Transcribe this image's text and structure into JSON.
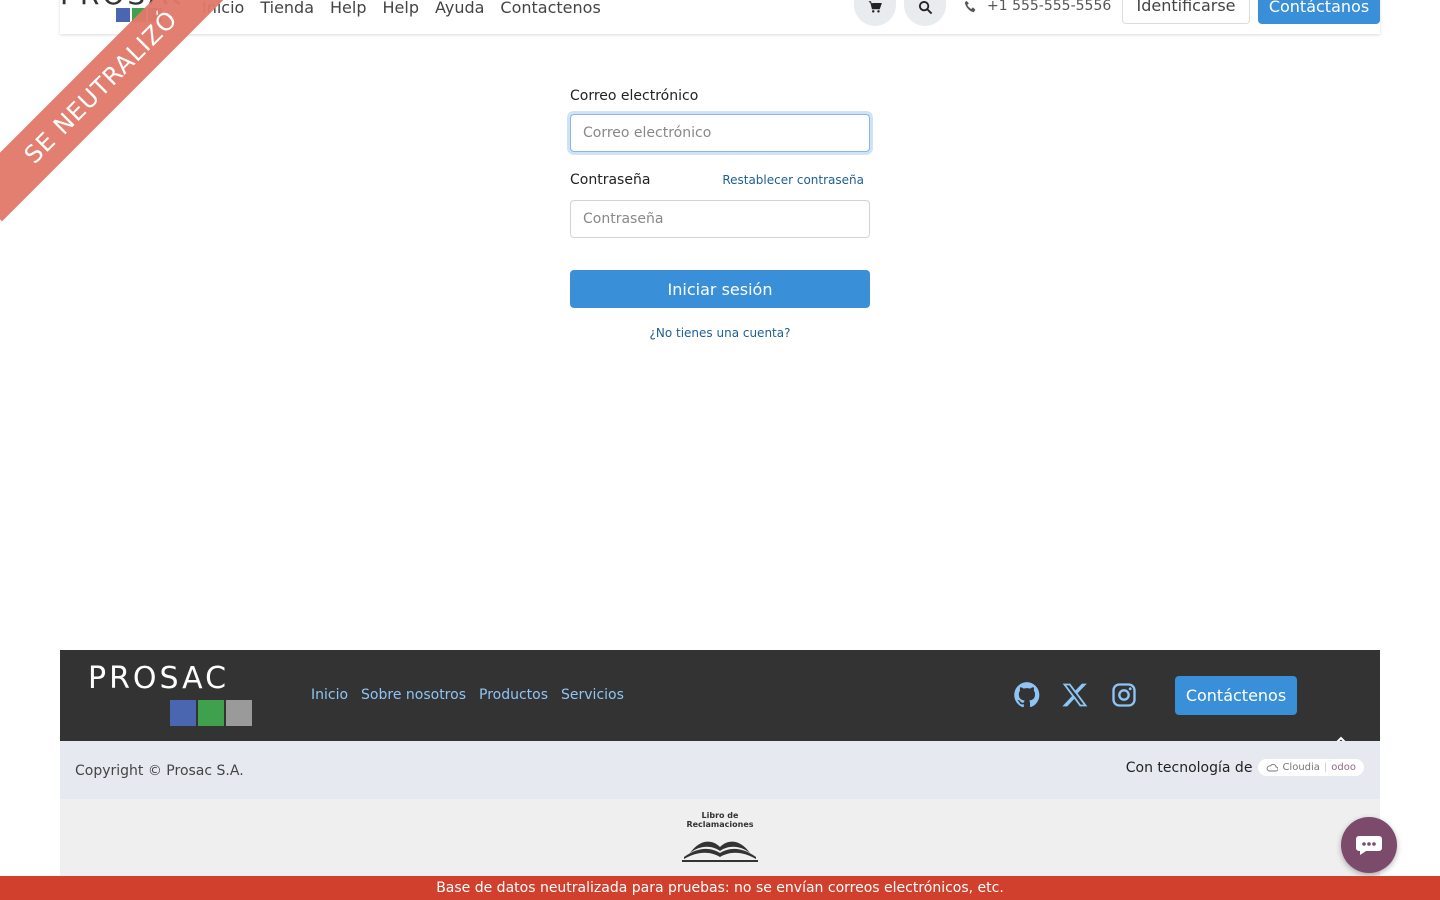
{
  "header": {
    "logo_text": "PROSAC",
    "nav": [
      "Inicio",
      "Tienda",
      "Help",
      "Help",
      "Ayuda",
      "Contactenos"
    ],
    "phone": "+1 555-555-5556",
    "login_button": "Identificarse",
    "contact_button": "Contáctanos"
  },
  "ribbon": "SE NEUTRALIZÓ",
  "login": {
    "email_label": "Correo electrónico",
    "email_placeholder": "Correo electrónico",
    "password_label": "Contraseña",
    "password_placeholder": "Contraseña",
    "reset_link": "Restablecer contraseña",
    "submit": "Iniciar sesión",
    "signup_link": "¿No tienes una cuenta?"
  },
  "footer": {
    "logo_text": "PROSAC",
    "links": [
      "Inicio",
      "Sobre nosotros",
      "Productos",
      "Servicios"
    ],
    "contact_button": "Contáctenos",
    "copyright": "Copyright © Prosac S.A.",
    "powered_by": "Con tecnología de",
    "powered_badge_left": "Cloudia",
    "powered_badge_right": "odoo",
    "book_title_line1": "Libro de",
    "book_title_line2": "Reclamaciones"
  },
  "banner": "Base de datos neutralizada para pruebas: no se envían correos electrónicos, etc.",
  "colors": {
    "primary": "#3a8fd9",
    "footer_dark": "#333333",
    "banner": "#d0402d",
    "ribbon": "#e2796a",
    "chat": "#7c4b6b"
  }
}
